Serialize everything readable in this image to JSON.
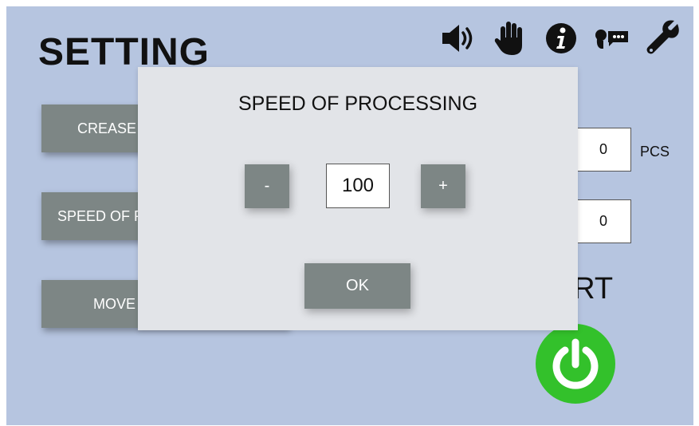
{
  "page": {
    "title": "SETTING"
  },
  "toolbar": {
    "icons": [
      "speaker-icon",
      "hand-stop-icon",
      "info-icon",
      "speech-icon",
      "wrench-icon"
    ]
  },
  "menu": {
    "items": [
      {
        "label": "CREASE"
      },
      {
        "label": "SPEED OF PROCESSING"
      },
      {
        "label": "MOVE"
      }
    ]
  },
  "counters": {
    "count_value": "0",
    "count_unit": "PCS",
    "second_value": "0"
  },
  "start": {
    "label": "START"
  },
  "dialog": {
    "title": "SPEED OF PROCESSING",
    "minus_label": "-",
    "plus_label": "+",
    "value": "100",
    "ok_label": "OK"
  },
  "colors": {
    "background": "#b6c5e0",
    "button": "#7d8685",
    "dialog": "#e2e4e8",
    "power": "#33c12b"
  }
}
